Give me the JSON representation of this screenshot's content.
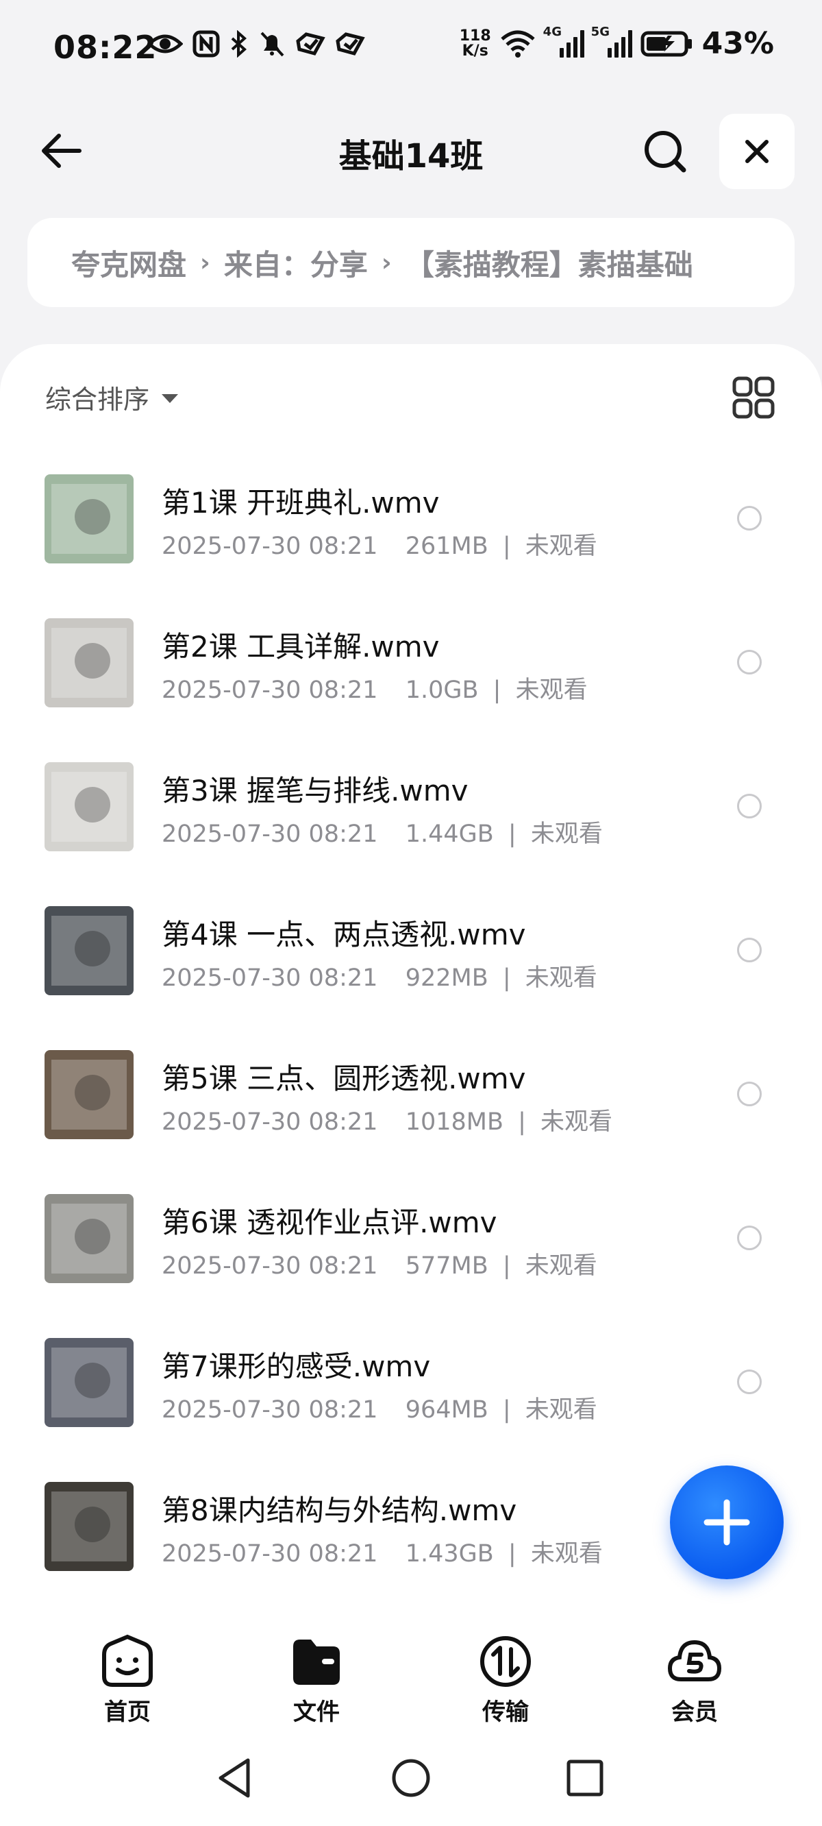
{
  "status_bar": {
    "time": "08:22",
    "net_speed_value": "118",
    "net_speed_unit": "K/s",
    "signal1_label": "4G",
    "signal2_label": "5G",
    "battery_percent": "43%"
  },
  "header": {
    "title": "基础14班"
  },
  "breadcrumb": {
    "items": [
      "夸克网盘",
      "来自：分享",
      "【素描教程】素描基础"
    ]
  },
  "toolbar": {
    "sort_label": "综合排序"
  },
  "files": [
    {
      "name": "第1课 开班典礼.wmv",
      "date": "2025-07-30 08:21",
      "size": "261MB",
      "status": "未观看",
      "thumb_color": "#9fb7a0"
    },
    {
      "name": "第2课 工具详解.wmv",
      "date": "2025-07-30 08:21",
      "size": "1.0GB",
      "status": "未观看",
      "thumb_color": "#c9c7c3"
    },
    {
      "name": "第3课 握笔与排线.wmv",
      "date": "2025-07-30 08:21",
      "size": "1.44GB",
      "status": "未观看",
      "thumb_color": "#d4d3cf"
    },
    {
      "name": "第4课 一点、两点透视.wmv",
      "date": "2025-07-30 08:21",
      "size": "922MB",
      "status": "未观看",
      "thumb_color": "#4a4f55"
    },
    {
      "name": "第5课 三点、圆形透视.wmv",
      "date": "2025-07-30 08:21",
      "size": "1018MB",
      "status": "未观看",
      "thumb_color": "#6b5a4a"
    },
    {
      "name": "第6课 透视作业点评.wmv",
      "date": "2025-07-30 08:21",
      "size": "577MB",
      "status": "未观看",
      "thumb_color": "#8d8d88"
    },
    {
      "name": "第7课形的感受.wmv",
      "date": "2025-07-30 08:21",
      "size": "964MB",
      "status": "未观看",
      "thumb_color": "#5a5e6a"
    },
    {
      "name": "第8课内结构与外结构.wmv",
      "date": "2025-07-30 08:21",
      "size": "1.43GB",
      "status": "未观看",
      "thumb_color": "#3e3b36"
    }
  ],
  "bottom_nav": {
    "items": [
      {
        "label": "首页",
        "icon": "home-face-icon"
      },
      {
        "label": "文件",
        "icon": "folder-icon"
      },
      {
        "label": "传输",
        "icon": "transfer-icon"
      },
      {
        "label": "会员",
        "icon": "cloud-vip-icon"
      }
    ]
  },
  "colors": {
    "accent": "#0a5cf0",
    "background": "#f3f3f5",
    "muted_text": "#8d8d92"
  }
}
